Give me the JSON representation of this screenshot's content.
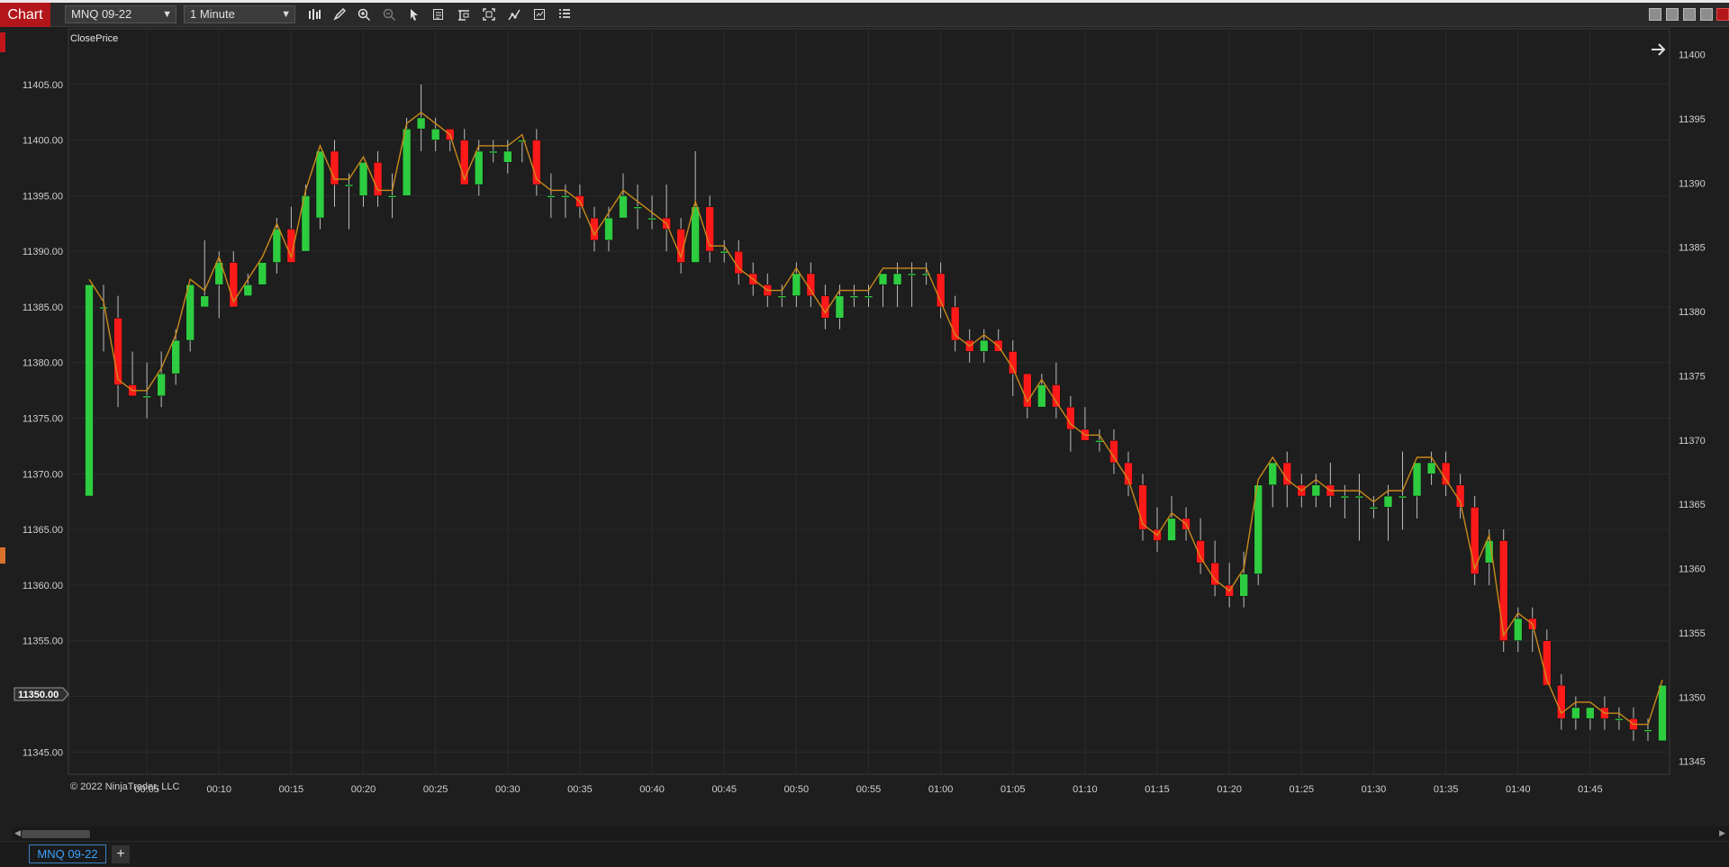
{
  "toolbar": {
    "chart_tab_label": "Chart",
    "instrument": "MNQ 09-22",
    "interval": "1 Minute",
    "tools": [
      "bar-type-icon",
      "pencil-icon",
      "zoom-in-icon",
      "zoom-out-icon",
      "pointer-icon",
      "data-box-icon",
      "properties-icon",
      "screenshot-icon",
      "strategies-icon",
      "list-icon"
    ]
  },
  "chart": {
    "indicator_label": "ClosePrice",
    "copyright": "© 2022 NinjaTrader, LLC",
    "current_price_label": "11350.00",
    "left_axis_ticks": [
      "11405.00",
      "11400.00",
      "11395.00",
      "11390.00",
      "11385.00",
      "11380.00",
      "11375.00",
      "11370.00",
      "11365.00",
      "11360.00",
      "11355.00",
      "11350.00",
      "11345.00"
    ],
    "right_axis_ticks": [
      "11400",
      "11395",
      "11390",
      "11385",
      "11380",
      "11375",
      "11370",
      "11365",
      "11360",
      "11355",
      "11350",
      "11345"
    ],
    "time_ticks": [
      "00:05",
      "00:10",
      "00:15",
      "00:20",
      "00:25",
      "00:30",
      "00:35",
      "00:40",
      "00:45",
      "00:50",
      "00:55",
      "01:00",
      "01:05",
      "01:10",
      "01:15",
      "01:20",
      "01:25",
      "01:30",
      "01:35",
      "01:40",
      "01:45"
    ],
    "colors": {
      "up": "#2ecc40",
      "down": "#ff1a1a",
      "line": "#c98a1a",
      "bg": "#1e1e1e",
      "grid": "#2b2b2b"
    }
  },
  "chart_data": {
    "type": "candlestick",
    "instrument": "MNQ 09-22",
    "interval": "1 Minute",
    "ylim_left": [
      11343,
      11410
    ],
    "ylim_right": [
      11344,
      11402
    ],
    "candles": [
      [
        11368,
        11387,
        11368,
        11387
      ],
      [
        11385,
        11387,
        11381,
        11385
      ],
      [
        11384,
        11386,
        11376,
        11378
      ],
      [
        11378,
        11381,
        11377,
        11377
      ],
      [
        11377,
        11380,
        11375,
        11377
      ],
      [
        11377,
        11381,
        11376,
        11379
      ],
      [
        11379,
        11383,
        11378,
        11382
      ],
      [
        11382,
        11387,
        11381,
        11387
      ],
      [
        11385,
        11391,
        11385,
        11386
      ],
      [
        11387,
        11390,
        11384,
        11389
      ],
      [
        11389,
        11390,
        11385,
        11385
      ],
      [
        11386,
        11388,
        11386,
        11387
      ],
      [
        11387,
        11389,
        11387,
        11389
      ],
      [
        11389,
        11393,
        11388,
        11392
      ],
      [
        11392,
        11394,
        11389,
        11389
      ],
      [
        11390,
        11396,
        11390,
        11395
      ],
      [
        11393,
        11399,
        11392,
        11399
      ],
      [
        11399,
        11400,
        11394,
        11396
      ],
      [
        11396,
        11397,
        11392,
        11396
      ],
      [
        11395,
        11398,
        11394,
        11398
      ],
      [
        11398,
        11399,
        11394,
        11395
      ],
      [
        11395,
        11397,
        11393,
        11395
      ],
      [
        11395,
        11402,
        11395,
        11401
      ],
      [
        11401,
        11405,
        11399,
        11402
      ],
      [
        11400,
        11402,
        11399,
        11401
      ],
      [
        11401,
        11401,
        11399,
        11400
      ],
      [
        11400,
        11401,
        11396,
        11396
      ],
      [
        11396,
        11400,
        11395,
        11399
      ],
      [
        11399,
        11400,
        11398,
        11399
      ],
      [
        11398,
        11400,
        11397,
        11399
      ],
      [
        11400,
        11400,
        11398,
        11400
      ],
      [
        11400,
        11401,
        11395,
        11396
      ],
      [
        11395,
        11397,
        11393,
        11395
      ],
      [
        11395,
        11396,
        11393,
        11395
      ],
      [
        11395,
        11396,
        11393,
        11394
      ],
      [
        11393,
        11394,
        11390,
        11391
      ],
      [
        11391,
        11394,
        11390,
        11393
      ],
      [
        11393,
        11397,
        11393,
        11395
      ],
      [
        11394,
        11396,
        11392,
        11394
      ],
      [
        11393,
        11395,
        11392,
        11393
      ],
      [
        11393,
        11396,
        11390,
        11392
      ],
      [
        11392,
        11393,
        11388,
        11389
      ],
      [
        11389,
        11399,
        11389,
        11394
      ],
      [
        11394,
        11395,
        11389,
        11390
      ],
      [
        11390,
        11391,
        11389,
        11390
      ],
      [
        11390,
        11391,
        11387,
        11388
      ],
      [
        11388,
        11389,
        11386,
        11387
      ],
      [
        11387,
        11388,
        11385,
        11386
      ],
      [
        11386,
        11387,
        11385,
        11386
      ],
      [
        11386,
        11389,
        11385,
        11388
      ],
      [
        11388,
        11389,
        11385,
        11386
      ],
      [
        11386,
        11387,
        11383,
        11384
      ],
      [
        11384,
        11387,
        11383,
        11386
      ],
      [
        11386,
        11387,
        11385,
        11386
      ],
      [
        11386,
        11387,
        11385,
        11386
      ],
      [
        11387,
        11388,
        11385,
        11388
      ],
      [
        11387,
        11389,
        11385,
        11388
      ],
      [
        11388,
        11389,
        11385,
        11388
      ],
      [
        11388,
        11389,
        11387,
        11388
      ],
      [
        11388,
        11389,
        11384,
        11385
      ],
      [
        11385,
        11386,
        11381,
        11382
      ],
      [
        11382,
        11383,
        11380,
        11381
      ],
      [
        11381,
        11383,
        11380,
        11382
      ],
      [
        11382,
        11383,
        11381,
        11381
      ],
      [
        11381,
        11382,
        11377,
        11379
      ],
      [
        11379,
        11379,
        11375,
        11376
      ],
      [
        11376,
        11379,
        11376,
        11378
      ],
      [
        11378,
        11380,
        11375,
        11376
      ],
      [
        11376,
        11377,
        11372,
        11374
      ],
      [
        11374,
        11376,
        11373,
        11373
      ],
      [
        11373,
        11374,
        11372,
        11373
      ],
      [
        11373,
        11374,
        11370,
        11371
      ],
      [
        11371,
        11372,
        11368,
        11369
      ],
      [
        11369,
        11370,
        11364,
        11365
      ],
      [
        11365,
        11367,
        11363,
        11364
      ],
      [
        11364,
        11368,
        11364,
        11366
      ],
      [
        11366,
        11367,
        11364,
        11365
      ],
      [
        11364,
        11366,
        11361,
        11362
      ],
      [
        11362,
        11364,
        11359,
        11360
      ],
      [
        11360,
        11362,
        11358,
        11359
      ],
      [
        11359,
        11363,
        11358,
        11361
      ],
      [
        11361,
        11369,
        11360,
        11369
      ],
      [
        11369,
        11371,
        11367,
        11371
      ],
      [
        11371,
        11372,
        11367,
        11369
      ],
      [
        11369,
        11370,
        11367,
        11368
      ],
      [
        11368,
        11370,
        11367,
        11369
      ],
      [
        11369,
        11371,
        11367,
        11368
      ],
      [
        11368,
        11369,
        11366,
        11368
      ],
      [
        11368,
        11370,
        11364,
        11368
      ],
      [
        11367,
        11368,
        11366,
        11367
      ],
      [
        11367,
        11369,
        11364,
        11368
      ],
      [
        11368,
        11372,
        11365,
        11368
      ],
      [
        11368,
        11371,
        11366,
        11371
      ],
      [
        11370,
        11372,
        11369,
        11371
      ],
      [
        11371,
        11372,
        11368,
        11369
      ],
      [
        11369,
        11370,
        11366,
        11367
      ],
      [
        11367,
        11368,
        11360,
        11361
      ],
      [
        11362,
        11365,
        11360,
        11364
      ],
      [
        11364,
        11365,
        11354,
        11355
      ],
      [
        11355,
        11358,
        11354,
        11357
      ],
      [
        11357,
        11358,
        11354,
        11356
      ],
      [
        11355,
        11356,
        11351,
        11351
      ],
      [
        11351,
        11352,
        11347,
        11348
      ],
      [
        11348,
        11350,
        11347,
        11349
      ],
      [
        11348,
        11349,
        11347,
        11349
      ],
      [
        11349,
        11350,
        11347,
        11348
      ],
      [
        11348,
        11349,
        11347,
        11348
      ],
      [
        11348,
        11349,
        11346,
        11347
      ],
      [
        11347,
        11348,
        11346,
        11347
      ],
      [
        11346,
        11351,
        11346,
        11351
      ]
    ]
  }
}
